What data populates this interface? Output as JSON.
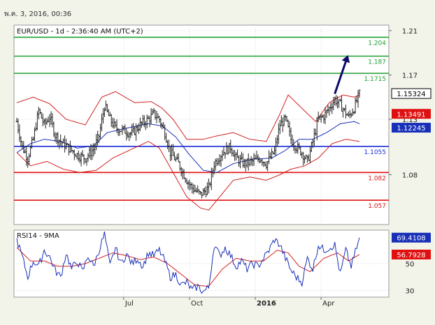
{
  "header": {
    "datetime": "พ.ค. 3, 2016, 00:36"
  },
  "colors": {
    "background": "#f2f4ea",
    "plot_bg": "#ffffff",
    "grid": "#d8d8d8",
    "price_bar": "#222222",
    "bollinger": "#d42020",
    "ma_blue": "#1830b8",
    "support": "#e01010",
    "resistance": "#20a030",
    "pivot": "#1a2bd6",
    "arrow": "#0a0a6a",
    "rsi": "#1830b8",
    "rsi_ma": "#d42020"
  },
  "chart_data": [
    {
      "type": "candlestick",
      "title": "EUR/USD - 1d - 2:36:40 AM (UTC+2)",
      "ylim": [
        1.035,
        1.215
      ],
      "y_ticks": [
        1.08,
        1.13,
        1.17,
        1.21
      ],
      "x_ticks": [
        "Jul",
        "Oct",
        "2016",
        "Apr"
      ],
      "grid": true,
      "horizontal_levels": [
        {
          "value": 1.204,
          "label": "1.204",
          "role": "resistance"
        },
        {
          "value": 1.187,
          "label": "1.187",
          "role": "resistance"
        },
        {
          "value": 1.1715,
          "label": "1.1715",
          "role": "resistance"
        },
        {
          "value": 1.1055,
          "label": "1.1055",
          "role": "pivot"
        },
        {
          "value": 1.082,
          "label": "1.082",
          "role": "support"
        },
        {
          "value": 1.057,
          "label": "1.057",
          "role": "support"
        }
      ],
      "price_tags": [
        {
          "value": 1.15324,
          "label": "1.15324",
          "style": "current"
        },
        {
          "value": 1.13491,
          "label": "1.13491",
          "style": "red"
        },
        {
          "value": 1.12245,
          "label": "1.12245",
          "style": "blue"
        }
      ],
      "forecast_arrow": {
        "from": [
          232,
          1.153
        ],
        "to": [
          240,
          1.182
        ]
      },
      "series_anchors": {
        "close": [
          [
            0,
            1.128
          ],
          [
            4,
            1.105
          ],
          [
            8,
            1.095
          ],
          [
            12,
            1.112
          ],
          [
            16,
            1.138
          ],
          [
            20,
            1.125
          ],
          [
            24,
            1.132
          ],
          [
            28,
            1.116
          ],
          [
            32,
            1.11
          ],
          [
            38,
            1.104
          ],
          [
            44,
            1.098
          ],
          [
            50,
            1.095
          ],
          [
            56,
            1.103
          ],
          [
            60,
            1.115
          ],
          [
            64,
            1.142
          ],
          [
            68,
            1.13
          ],
          [
            72,
            1.122
          ],
          [
            78,
            1.12
          ],
          [
            84,
            1.117
          ],
          [
            90,
            1.125
          ],
          [
            96,
            1.13
          ],
          [
            100,
            1.135
          ],
          [
            104,
            1.13
          ],
          [
            108,
            1.118
          ],
          [
            112,
            1.1
          ],
          [
            118,
            1.09
          ],
          [
            124,
            1.075
          ],
          [
            128,
            1.068
          ],
          [
            134,
            1.062
          ],
          [
            140,
            1.068
          ],
          [
            144,
            1.09
          ],
          [
            150,
            1.1
          ],
          [
            156,
            1.105
          ],
          [
            160,
            1.095
          ],
          [
            166,
            1.09
          ],
          [
            172,
            1.092
          ],
          [
            178,
            1.095
          ],
          [
            182,
            1.09
          ],
          [
            188,
            1.101
          ],
          [
            192,
            1.125
          ],
          [
            196,
            1.13
          ],
          [
            200,
            1.112
          ],
          [
            204,
            1.105
          ],
          [
            208,
            1.1
          ],
          [
            212,
            1.092
          ],
          [
            216,
            1.11
          ],
          [
            220,
            1.13
          ],
          [
            224,
            1.133
          ],
          [
            228,
            1.14
          ],
          [
            232,
            1.148
          ],
          [
            236,
            1.143
          ],
          [
            242,
            1.132
          ],
          [
            246,
            1.14
          ],
          [
            250,
            1.153
          ]
        ],
        "ma": [
          [
            0,
            1.1
          ],
          [
            10,
            1.108
          ],
          [
            20,
            1.112
          ],
          [
            32,
            1.11
          ],
          [
            44,
            1.104
          ],
          [
            56,
            1.106
          ],
          [
            66,
            1.118
          ],
          [
            80,
            1.122
          ],
          [
            96,
            1.126
          ],
          [
            106,
            1.124
          ],
          [
            116,
            1.114
          ],
          [
            126,
            1.098
          ],
          [
            136,
            1.084
          ],
          [
            146,
            1.082
          ],
          [
            158,
            1.09
          ],
          [
            172,
            1.094
          ],
          [
            186,
            1.095
          ],
          [
            196,
            1.102
          ],
          [
            206,
            1.112
          ],
          [
            216,
            1.112
          ],
          [
            226,
            1.118
          ],
          [
            236,
            1.126
          ],
          [
            246,
            1.128
          ],
          [
            250,
            1.126
          ]
        ],
        "bb_upper": [
          [
            0,
            1.145
          ],
          [
            12,
            1.15
          ],
          [
            24,
            1.144
          ],
          [
            36,
            1.13
          ],
          [
            50,
            1.125
          ],
          [
            62,
            1.15
          ],
          [
            72,
            1.155
          ],
          [
            86,
            1.145
          ],
          [
            98,
            1.146
          ],
          [
            106,
            1.14
          ],
          [
            114,
            1.13
          ],
          [
            124,
            1.112
          ],
          [
            136,
            1.112
          ],
          [
            146,
            1.115
          ],
          [
            158,
            1.118
          ],
          [
            170,
            1.112
          ],
          [
            182,
            1.11
          ],
          [
            192,
            1.135
          ],
          [
            198,
            1.152
          ],
          [
            208,
            1.14
          ],
          [
            218,
            1.128
          ],
          [
            228,
            1.145
          ],
          [
            238,
            1.152
          ],
          [
            246,
            1.15
          ],
          [
            250,
            1.152
          ]
        ],
        "bb_lower": [
          [
            0,
            1.1
          ],
          [
            10,
            1.088
          ],
          [
            22,
            1.092
          ],
          [
            34,
            1.085
          ],
          [
            46,
            1.082
          ],
          [
            58,
            1.084
          ],
          [
            70,
            1.095
          ],
          [
            82,
            1.102
          ],
          [
            96,
            1.11
          ],
          [
            104,
            1.104
          ],
          [
            114,
            1.082
          ],
          [
            124,
            1.06
          ],
          [
            134,
            1.05
          ],
          [
            140,
            1.048
          ],
          [
            148,
            1.06
          ],
          [
            158,
            1.075
          ],
          [
            170,
            1.078
          ],
          [
            182,
            1.075
          ],
          [
            192,
            1.08
          ],
          [
            200,
            1.085
          ],
          [
            210,
            1.088
          ],
          [
            220,
            1.095
          ],
          [
            230,
            1.108
          ],
          [
            240,
            1.112
          ],
          [
            250,
            1.11
          ]
        ]
      }
    },
    {
      "type": "line",
      "title": "RSI14 - 9MA",
      "ylim": [
        25,
        75
      ],
      "y_ticks": [
        30,
        50
      ],
      "grid": true,
      "price_tags": [
        {
          "value": 69.4108,
          "label": "69.4108",
          "style": "blue"
        },
        {
          "value": 56.7928,
          "label": "56.7928",
          "style": "red"
        }
      ],
      "series_anchors": {
        "rsi": [
          [
            0,
            68
          ],
          [
            4,
            55
          ],
          [
            8,
            40
          ],
          [
            12,
            52
          ],
          [
            16,
            48
          ],
          [
            20,
            60
          ],
          [
            24,
            55
          ],
          [
            28,
            45
          ],
          [
            32,
            40
          ],
          [
            36,
            58
          ],
          [
            40,
            46
          ],
          [
            44,
            52
          ],
          [
            48,
            44
          ],
          [
            52,
            56
          ],
          [
            56,
            48
          ],
          [
            60,
            60
          ],
          [
            64,
            72
          ],
          [
            68,
            48
          ],
          [
            72,
            62
          ],
          [
            76,
            50
          ],
          [
            80,
            57
          ],
          [
            84,
            50
          ],
          [
            88,
            54
          ],
          [
            92,
            48
          ],
          [
            96,
            58
          ],
          [
            100,
            56
          ],
          [
            104,
            60
          ],
          [
            108,
            52
          ],
          [
            112,
            40
          ],
          [
            116,
            42
          ],
          [
            120,
            34
          ],
          [
            124,
            36
          ],
          [
            128,
            30
          ],
          [
            132,
            33
          ],
          [
            136,
            29
          ],
          [
            140,
            32
          ],
          [
            144,
            64
          ],
          [
            148,
            56
          ],
          [
            152,
            62
          ],
          [
            156,
            56
          ],
          [
            160,
            48
          ],
          [
            164,
            52
          ],
          [
            168,
            46
          ],
          [
            172,
            50
          ],
          [
            176,
            48
          ],
          [
            180,
            54
          ],
          [
            184,
            60
          ],
          [
            188,
            68
          ],
          [
            192,
            64
          ],
          [
            196,
            54
          ],
          [
            200,
            45
          ],
          [
            204,
            40
          ],
          [
            208,
            36
          ],
          [
            212,
            54
          ],
          [
            216,
            46
          ],
          [
            220,
            64
          ],
          [
            224,
            60
          ],
          [
            228,
            62
          ],
          [
            232,
            64
          ],
          [
            236,
            42
          ],
          [
            240,
            60
          ],
          [
            244,
            48
          ],
          [
            250,
            69.4
          ]
        ],
        "rsi_ma": [
          [
            0,
            62
          ],
          [
            10,
            52
          ],
          [
            20,
            52
          ],
          [
            30,
            48
          ],
          [
            40,
            48
          ],
          [
            50,
            50
          ],
          [
            60,
            54
          ],
          [
            70,
            58
          ],
          [
            80,
            56
          ],
          [
            90,
            53
          ],
          [
            100,
            55
          ],
          [
            110,
            50
          ],
          [
            120,
            42
          ],
          [
            130,
            34
          ],
          [
            140,
            33
          ],
          [
            150,
            46
          ],
          [
            160,
            54
          ],
          [
            170,
            52
          ],
          [
            180,
            52
          ],
          [
            190,
            60
          ],
          [
            198,
            58
          ],
          [
            206,
            48
          ],
          [
            214,
            44
          ],
          [
            224,
            54
          ],
          [
            234,
            58
          ],
          [
            242,
            52
          ],
          [
            250,
            56.8
          ]
        ]
      }
    }
  ]
}
